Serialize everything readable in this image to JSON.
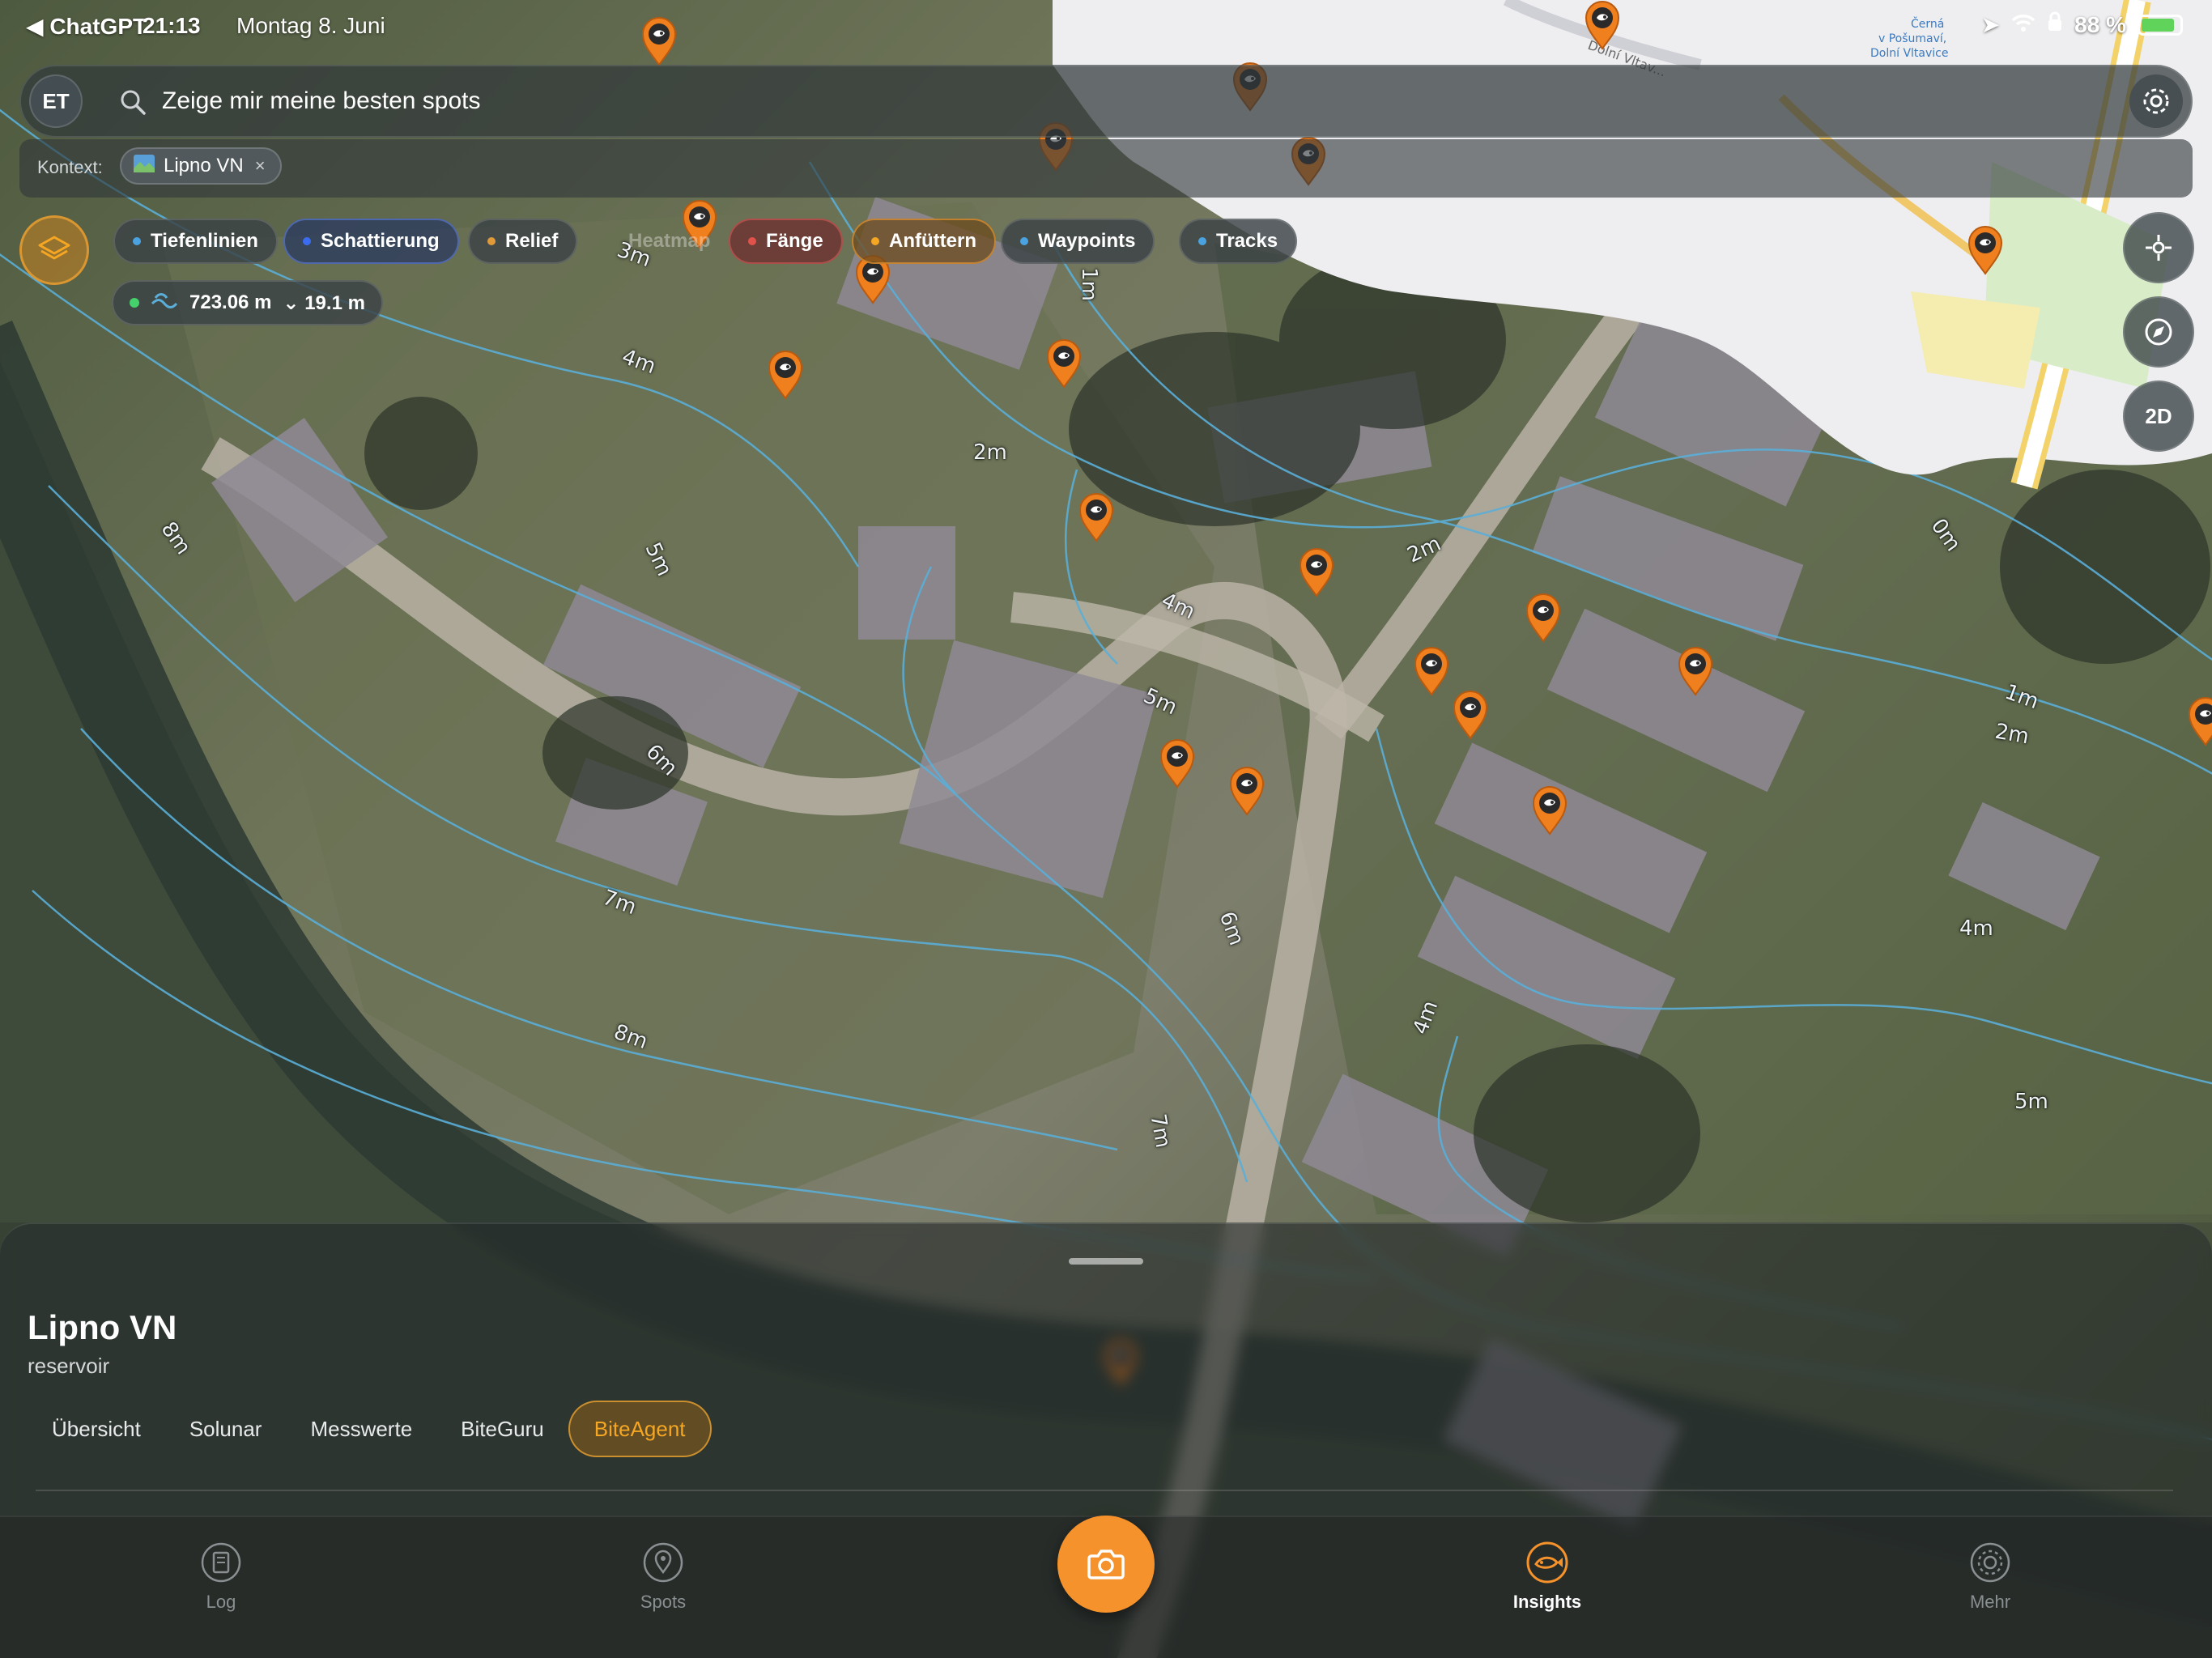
{
  "status_bar": {
    "back_app": "◀ ChatGPT",
    "time": "21:13",
    "date": "Montag 8. Juni",
    "battery": "88 %"
  },
  "search": {
    "avatar_initials": "ET",
    "query": "Zeige mir meine besten spots",
    "context_label": "Kontext:",
    "context_chip": "Lipno VN",
    "context_chip_remove": "×"
  },
  "layers": [
    {
      "label": "Tiefenlinien",
      "dot": "#4aa3e0",
      "style": "normal"
    },
    {
      "label": "Schattierung",
      "dot": "#3b6cf0",
      "style": "blue"
    },
    {
      "label": "Relief",
      "dot": "#e09a3a",
      "style": "normal"
    },
    {
      "label": "Heatmap",
      "dot": "",
      "style": "dim"
    },
    {
      "label": "Fänge",
      "dot": "#e0524a",
      "style": "red"
    },
    {
      "label": "Anfüttern",
      "dot": "#f5a623",
      "style": "orange"
    },
    {
      "label": "Waypoints",
      "dot": "#4aa3e0",
      "style": "normal"
    },
    {
      "label": "Tracks",
      "dot": "#4aa3e0",
      "style": "normal"
    }
  ],
  "depth": {
    "elevation": "723.06 m",
    "depth": "⌄ 19.1 m"
  },
  "map_controls": {
    "view_mode": "2D"
  },
  "map_labels": {
    "contours": [
      "3m",
      "4m",
      "2m",
      "1m",
      "8m",
      "5m",
      "4m",
      "5m",
      "6m",
      "7m",
      "8m",
      "6m",
      "7m",
      "4m",
      "2m",
      "0m",
      "1m",
      "2m",
      "4m",
      "5m"
    ],
    "osm_place": [
      "Černá",
      "v Pošumaví,",
      "Dolní Vltavice"
    ],
    "osm_road": "Dolní Vltav..."
  },
  "sheet": {
    "title": "Lipno VN",
    "subtitle": "reservoir",
    "tabs": [
      "Übersicht",
      "Solunar",
      "Messwerte",
      "BiteGuru",
      "BiteAgent"
    ],
    "active_tab": "BiteAgent"
  },
  "tabbar": {
    "items": [
      "Log",
      "Spots",
      "Insights",
      "Mehr"
    ],
    "active": "Insights"
  },
  "colors": {
    "accent": "#f5922b",
    "contour": "#5aaed8",
    "pin": "#f07f1e"
  }
}
